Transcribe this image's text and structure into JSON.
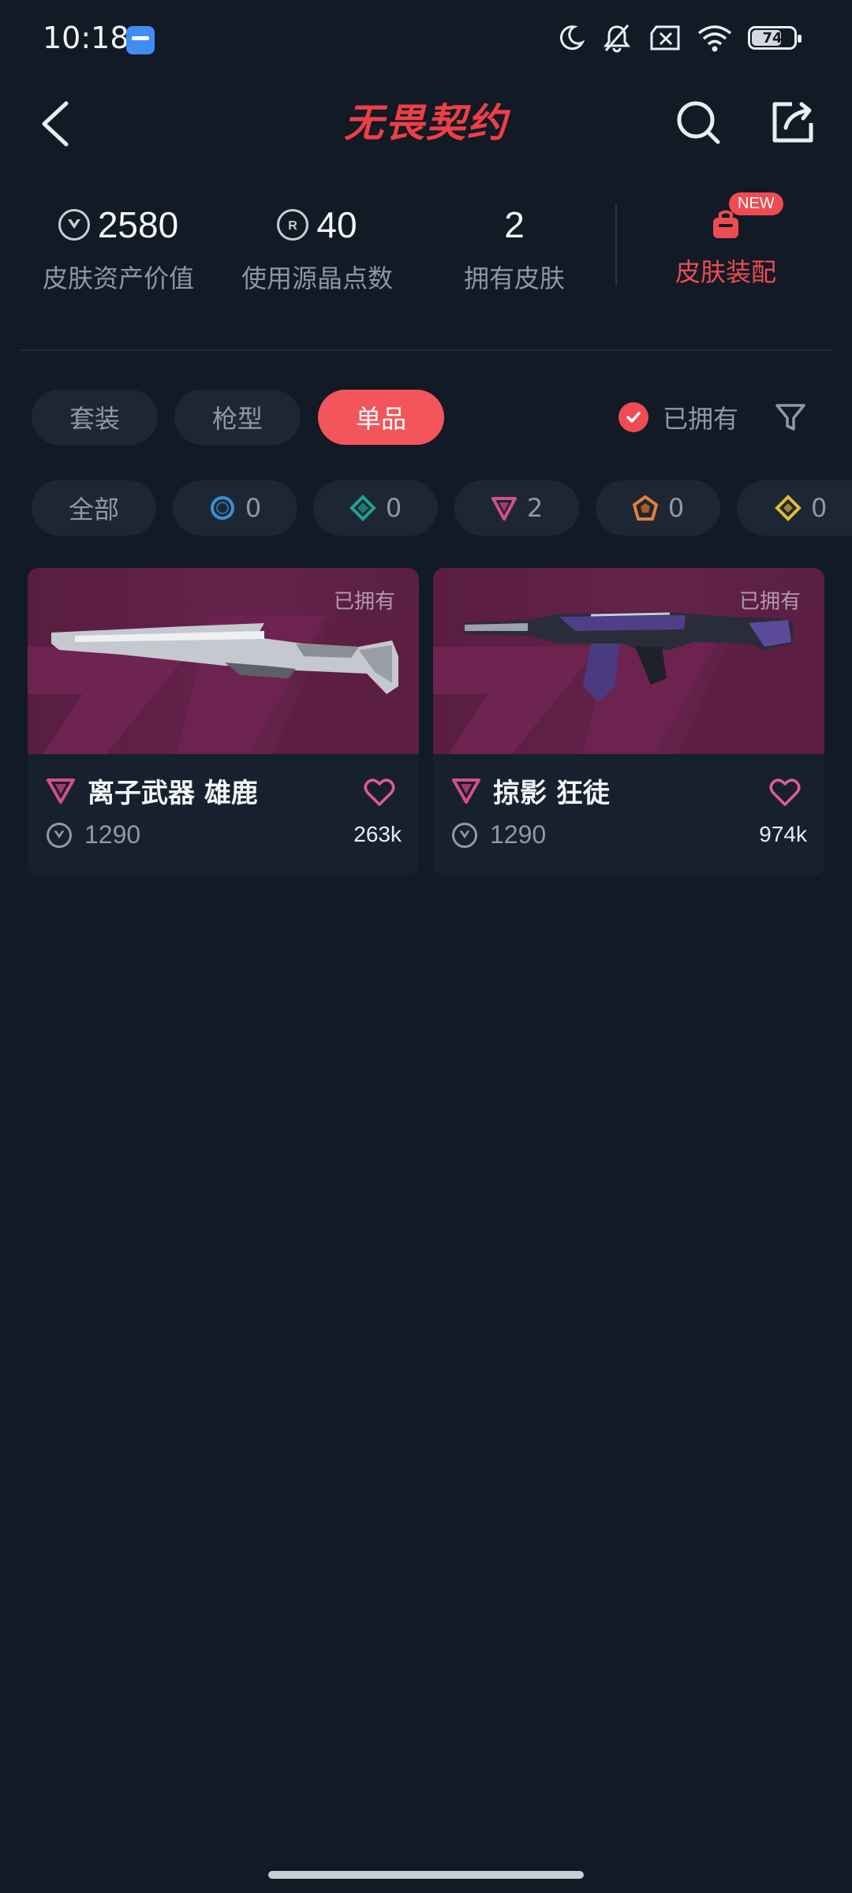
{
  "status_bar": {
    "time": "10:18",
    "battery": "74",
    "battery_level": 0.74
  },
  "header": {
    "logo_text": "无畏契约"
  },
  "stats": {
    "asset_value": "2580",
    "asset_value_label": "皮肤资产价值",
    "radianite_points": "40",
    "radianite_points_label": "使用源晶点数",
    "owned_skins": "2",
    "owned_skins_label": "拥有皮肤",
    "loadout_label": "皮肤装配",
    "new_badge": "NEW"
  },
  "tabs": [
    {
      "label": "套装",
      "active": false
    },
    {
      "label": "枪型",
      "active": false
    },
    {
      "label": "单品",
      "active": true
    }
  ],
  "owned_filter": {
    "label": "已拥有",
    "checked": true
  },
  "rarity_chips": [
    {
      "label": "全部"
    },
    {
      "icon": "select-tier-icon",
      "color": "#3a8fd6",
      "count": "0"
    },
    {
      "icon": "deluxe-tier-icon",
      "color": "#1ea392",
      "count": "0"
    },
    {
      "icon": "premium-tier-icon",
      "color": "#d24f8b",
      "count": "2"
    },
    {
      "icon": "exclusive-tier-icon",
      "color": "#e57f3a",
      "count": "0"
    },
    {
      "icon": "ultra-tier-icon",
      "color": "#e2b93b",
      "count": "0"
    }
  ],
  "cards": [
    {
      "owned_label": "已拥有",
      "title": "离子武器 雄鹿",
      "price": "1290",
      "likes": "263k",
      "tier_icon": "premium-tier-icon"
    },
    {
      "owned_label": "已拥有",
      "title": "掠影 狂徒",
      "price": "1290",
      "likes": "974k",
      "tier_icon": "premium-tier-icon"
    }
  ],
  "colors": {
    "background": "#111a25",
    "accent": "#ef4b53",
    "card_bg": "#17212d",
    "premium": "#d24f8b"
  }
}
